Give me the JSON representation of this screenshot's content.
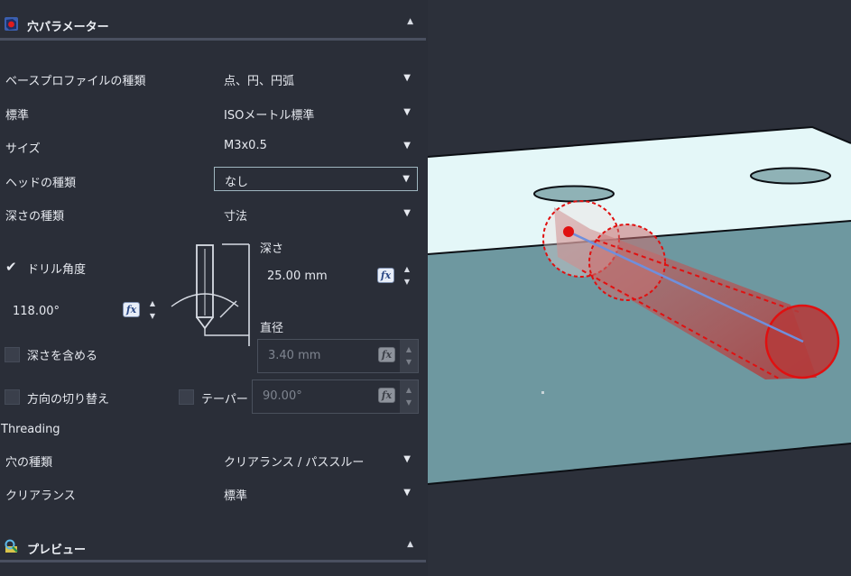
{
  "hole_params": {
    "header": "穴パラメーター",
    "rows": [
      {
        "label": "ベースプロファイルの種類",
        "value": "点、円、円弧"
      },
      {
        "label": "標準",
        "value": "ISOメートル標準"
      },
      {
        "label": "サイズ",
        "value": "M3x0.5"
      },
      {
        "label": "ヘッドの種類",
        "value": "なし"
      },
      {
        "label": "深さの種類",
        "value": "寸法"
      }
    ],
    "drill_angle": {
      "label": "ドリル角度",
      "checked": true,
      "value": "118.00°"
    },
    "depth": {
      "label": "深さ",
      "value": "25.00 mm"
    },
    "diameter": {
      "label": "直径",
      "value": "3.40 mm"
    },
    "include_depth": {
      "label": "深さを含める",
      "checked": false
    },
    "flip_direction": {
      "label": "方向の切り替え",
      "checked": false
    },
    "taper": {
      "label": "テーパー",
      "checked": false,
      "value": "90.00°"
    },
    "threading": {
      "header": "Threading",
      "rows": [
        {
          "label": "穴の種類",
          "value": "クリアランス / パススルー"
        },
        {
          "label": "クリアランス",
          "value": "標準"
        }
      ]
    }
  },
  "preview": {
    "header": "プレビュー"
  },
  "icons": {
    "hole_params": "hole-params-icon",
    "preview": "preview-icon",
    "fx": "fx-icon",
    "collapse": "chevron-up-icon",
    "dropdown": "chevron-down-icon"
  },
  "colors": {
    "panel_bg": "#2a2e38",
    "block_top": "#e4f7f8",
    "block_front": "#6e98a0",
    "preview_red": "#e01010",
    "axis_blue": "#6f8fdc"
  }
}
